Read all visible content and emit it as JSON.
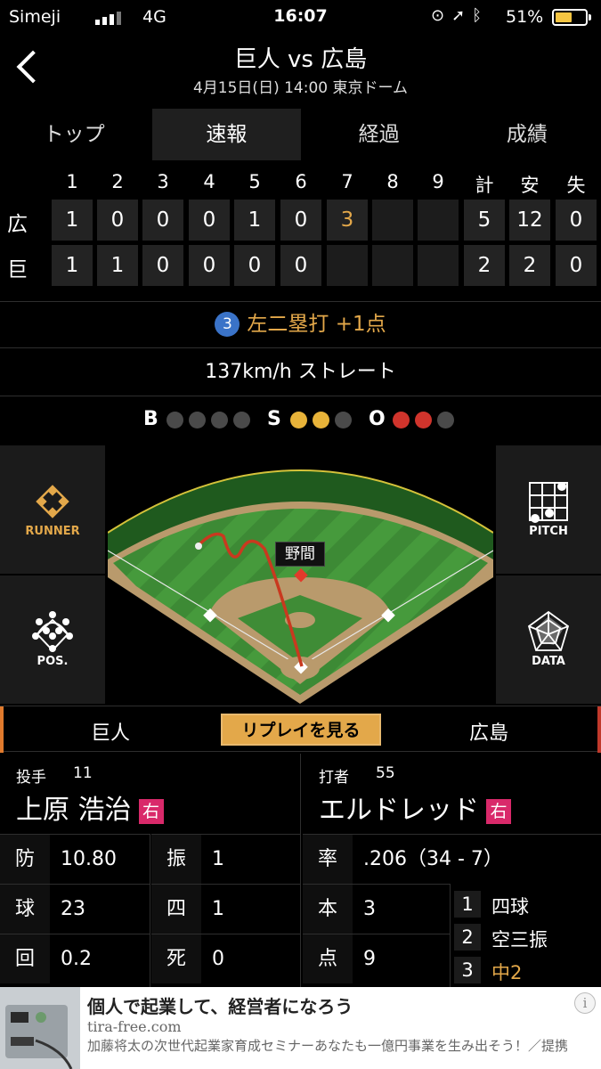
{
  "status_bar": {
    "carrier": "Simeji",
    "network": "4G",
    "time": "16:07",
    "battery": "51%",
    "icons": [
      "orientation-lock-icon",
      "location-icon",
      "bluetooth-icon"
    ]
  },
  "header": {
    "title": "巨人 vs 広島",
    "subtitle": "4月15日(日) 14:00 東京ドーム"
  },
  "tabs": [
    {
      "label": "トップ",
      "active": false
    },
    {
      "label": "速報",
      "active": true
    },
    {
      "label": "経過",
      "active": false
    },
    {
      "label": "成績",
      "active": false
    }
  ],
  "scoreboard": {
    "headers": [
      "1",
      "2",
      "3",
      "4",
      "5",
      "6",
      "7",
      "8",
      "9",
      "計",
      "安",
      "失"
    ],
    "rows": [
      {
        "team": "広",
        "innings": [
          "1",
          "0",
          "0",
          "0",
          "1",
          "0",
          "3",
          "",
          ""
        ],
        "totals": [
          "5",
          "12",
          "0"
        ]
      },
      {
        "team": "巨",
        "innings": [
          "1",
          "1",
          "0",
          "0",
          "0",
          "0",
          "",
          "",
          ""
        ],
        "totals": [
          "2",
          "2",
          "0"
        ]
      }
    ],
    "highlight_color": "#e3a84a"
  },
  "play": {
    "number": "3",
    "text": "左二塁打 +1点",
    "pitch": "137km/h ストレート"
  },
  "count": {
    "b_label": "B",
    "s_label": "S",
    "o_label": "O",
    "balls": 0,
    "strikes": 2,
    "outs": 2,
    "ball_slots": 4,
    "strike_slots": 3,
    "out_slots": 3,
    "strike_color": "#e8b339",
    "out_color": "#d0342c"
  },
  "side_buttons": {
    "runner": "RUNNER",
    "pos": "POS.",
    "pitch": "PITCH",
    "data": "DATA"
  },
  "field": {
    "fielder_label": "野間"
  },
  "teams_bar": {
    "home": "巨人",
    "replay": "リプレイを見る",
    "away": "広島"
  },
  "pitcher": {
    "role": "投手",
    "number": "11",
    "name": "上原 浩治",
    "hand": "右",
    "stats": [
      {
        "key": "防",
        "value": "10.80"
      },
      {
        "key": "球",
        "value": "23"
      },
      {
        "key": "回",
        "value": "0.2"
      }
    ],
    "stats2": [
      {
        "key": "振",
        "value": "1"
      },
      {
        "key": "四",
        "value": "1"
      },
      {
        "key": "死",
        "value": "0"
      }
    ]
  },
  "batter": {
    "role": "打者",
    "number": "55",
    "name": "エルドレッド",
    "hand": "右",
    "stats": [
      {
        "key": "率",
        "value": ".206（34 - 7）"
      },
      {
        "key": "本",
        "value": "3"
      },
      {
        "key": "点",
        "value": "9"
      }
    ],
    "at_bats": [
      {
        "n": "1",
        "result": "四球",
        "highlight": false
      },
      {
        "n": "2",
        "result": "空三振",
        "highlight": false
      },
      {
        "n": "3",
        "result": "中2",
        "highlight": true
      }
    ]
  },
  "ad": {
    "headline": "個人で起業して、経営者になろう",
    "url": "tira-free.com",
    "body": "加藤将太の次世代起業家育成セミナーあなたも一億円事業を生み出そう！／提携",
    "info_icon": "i"
  }
}
